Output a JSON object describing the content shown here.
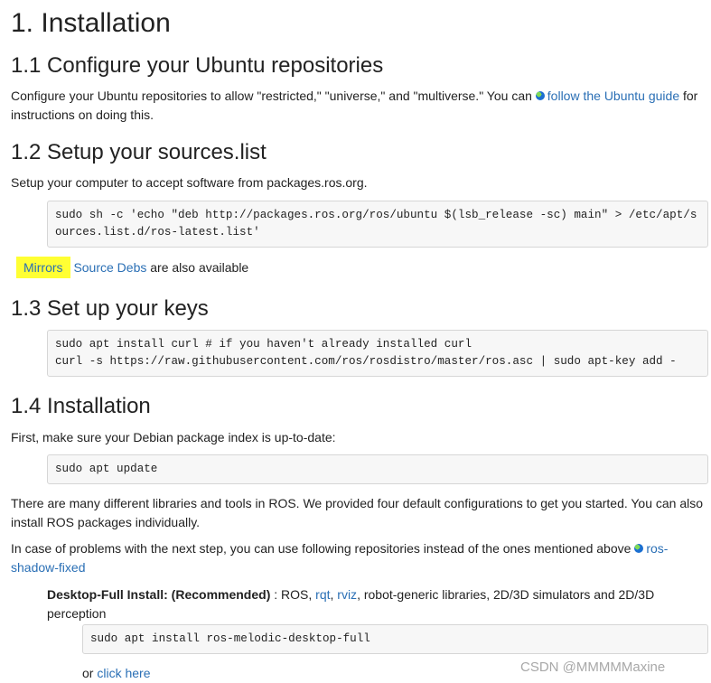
{
  "h_installation": "1. Installation",
  "s1": {
    "title": "1.1 Configure your Ubuntu repositories",
    "text_before": "Configure your Ubuntu repositories to allow \"restricted,\" \"universe,\" and \"multiverse.\" You can ",
    "link": "follow the Ubuntu guide",
    "text_after": " for instructions on doing this."
  },
  "s2": {
    "title": "1.2 Setup your sources.list",
    "text": "Setup your computer to accept software from packages.ros.org.",
    "code": "sudo sh -c 'echo \"deb http://packages.ros.org/ros/ubuntu $(lsb_release -sc) main\" > /etc/apt/sources.list.d/ros-latest.list'",
    "mirrors": "Mirrors",
    "source_debs": "Source Debs",
    "also_available": " are also available"
  },
  "s3": {
    "title": "1.3 Set up your keys",
    "code": "sudo apt install curl # if you haven't already installed curl\ncurl -s https://raw.githubusercontent.com/ros/rosdistro/master/ros.asc | sudo apt-key add -"
  },
  "s4": {
    "title": "1.4 Installation",
    "text": "First, make sure your Debian package index is up-to-date:",
    "code": "sudo apt update",
    "para1": "There are many different libraries and tools in ROS. We provided four default configurations to get you started. You can also install ROS packages individually.",
    "para2_before": "In case of problems with the next step, you can use following repositories instead of the ones mentioned above ",
    "para2_link": "ros-shadow-fixed",
    "desktop_label": "Desktop-Full Install: (Recommended)",
    "desktop_sep": " : ROS, ",
    "rqt": "rqt",
    "comma": ", ",
    "rviz": "rviz",
    "desktop_rest": ", robot-generic libraries, 2D/3D simulators and 2D/3D perception",
    "desktop_code": "sudo apt install ros-melodic-desktop-full",
    "or_text": "or ",
    "click_here": "click here"
  },
  "watermark": "CSDN @MMMMMaxine"
}
